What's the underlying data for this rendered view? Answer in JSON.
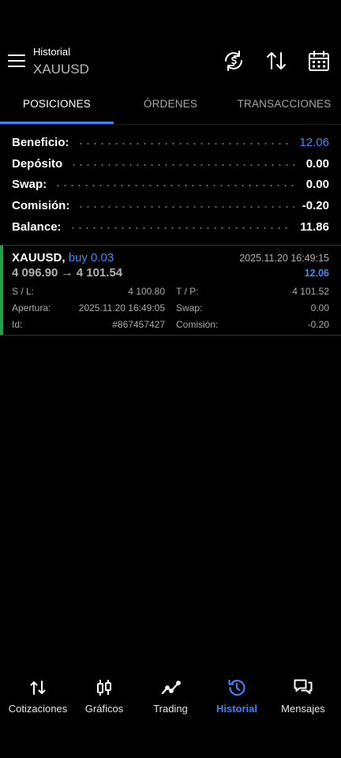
{
  "header": {
    "title": "Historial",
    "symbol": "XAUUSD",
    "icons": [
      "menu-icon",
      "dollar-refresh-icon",
      "sort-arrows-icon",
      "calendar-icon"
    ]
  },
  "tabs": [
    {
      "label": "POSICIONES",
      "active": true
    },
    {
      "label": "ÓRDENES",
      "active": false
    },
    {
      "label": "TRANSACCIONES",
      "active": false
    }
  ],
  "summary": [
    {
      "label": "Beneficio:",
      "value": "12.06",
      "highlight": true
    },
    {
      "label": "Depósito",
      "value": "0.00",
      "highlight": false
    },
    {
      "label": "Swap:",
      "value": "0.00",
      "highlight": false
    },
    {
      "label": "Comisión:",
      "value": "-0.20",
      "highlight": false
    },
    {
      "label": "Balance:",
      "value": "11.86",
      "highlight": false
    }
  ],
  "position": {
    "symbol": "XAUUSD,",
    "side": "buy 0.03",
    "price_open": "4 096.90",
    "arrow": "→",
    "price_close": "4 101.54",
    "close_time": "2025.11.20 16:49:15",
    "profit": "12.06",
    "details": {
      "sl_label": "S / L:",
      "sl_value": "4 100.80",
      "tp_label": "T / P:",
      "tp_value": "4 101.52",
      "open_label": "Apertura:",
      "open_value": "2025.11.20 16:49:05",
      "swap_label": "Swap:",
      "swap_value": "0.00",
      "id_label": "Id:",
      "id_value": "#867457427",
      "commission_label": "Comisión:",
      "commission_value": "-0.20"
    }
  },
  "nav": [
    {
      "label": "Cotizaciones",
      "icon": "quotes-arrows-icon",
      "active": false
    },
    {
      "label": "Gráficos",
      "icon": "candlestick-icon",
      "active": false
    },
    {
      "label": "Trading",
      "icon": "trend-line-icon",
      "active": false
    },
    {
      "label": "Historial",
      "icon": "history-clock-icon",
      "active": true
    },
    {
      "label": "Mensajes",
      "icon": "chat-bubbles-icon",
      "active": false
    }
  ],
  "colors": {
    "accent": "#3b82f6",
    "profit_bar": "#1fa34a",
    "background": "#000000"
  }
}
